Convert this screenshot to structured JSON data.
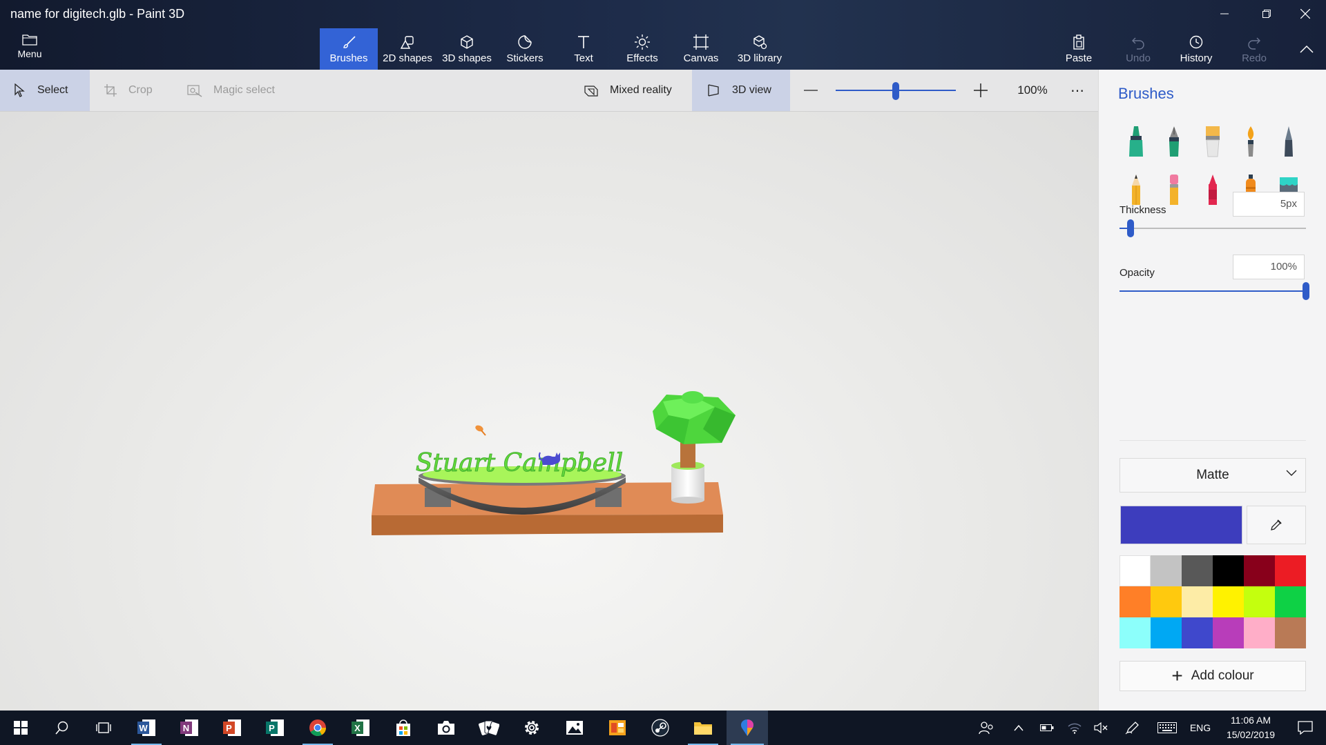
{
  "window": {
    "title": "name for digitech.glb - Paint 3D"
  },
  "ribbon": {
    "menu_label": "Menu",
    "tabs": [
      {
        "label": "Brushes"
      },
      {
        "label": "2D shapes"
      },
      {
        "label": "3D shapes"
      },
      {
        "label": "Stickers"
      },
      {
        "label": "Text"
      },
      {
        "label": "Effects"
      },
      {
        "label": "Canvas"
      },
      {
        "label": "3D library"
      }
    ],
    "active_tab": "Brushes",
    "actions": [
      {
        "label": "Paste"
      },
      {
        "label": "Undo"
      },
      {
        "label": "History"
      },
      {
        "label": "Redo"
      }
    ]
  },
  "toolbar": {
    "select": "Select",
    "crop": "Crop",
    "magic_select": "Magic select",
    "mixed_reality": "Mixed reality",
    "view_3d": "3D view",
    "zoom_value": "100%",
    "zoom_level": 0.5,
    "more": "⋯"
  },
  "canvas": {
    "text_3d": "Stuart Campbell"
  },
  "panel": {
    "title": "Brushes",
    "brushes": [
      "marker",
      "calligraphy-pen",
      "oil-brush",
      "watercolor",
      "pixel-pen",
      "pencil",
      "eraser",
      "crayon",
      "spray-can",
      "fill"
    ],
    "thickness_label": "Thickness",
    "thickness_value": "5px",
    "thickness_level": 0.06,
    "opacity_label": "Opacity",
    "opacity_value": "100%",
    "opacity_level": 1.0,
    "material": "Matte",
    "current_colour": "#3d3dbd",
    "palette": [
      "#ffffff",
      "#c3c3c3",
      "#585858",
      "#000000",
      "#88001b",
      "#ec1c24",
      "#ff7f27",
      "#ffc90e",
      "#fdeca6",
      "#fff200",
      "#c4ff0e",
      "#0ed145",
      "#8cfffb",
      "#00a8f3",
      "#3f48cc",
      "#b83dba",
      "#ffaec8",
      "#b97a56"
    ],
    "add_colour": "Add colour"
  },
  "taskbar": {
    "language": "ENG",
    "time": "11:06 AM",
    "date": "15/02/2019"
  }
}
